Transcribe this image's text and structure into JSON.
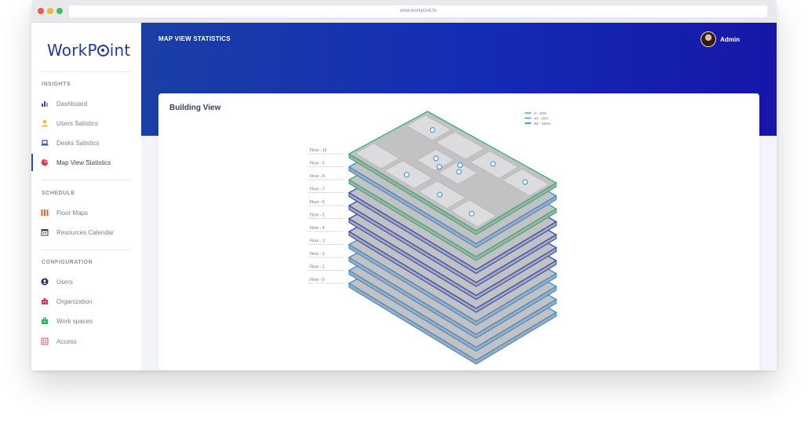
{
  "browser": {
    "url": "www.workpoint.tn"
  },
  "app": {
    "logo_prefix": "WorkP",
    "logo_suffix": "int"
  },
  "sidebar": {
    "sections": [
      {
        "title": "INSIGHTS",
        "items": [
          {
            "label": "Dashboard",
            "icon": "bar-chart-icon"
          },
          {
            "label": "Users Satistics",
            "icon": "user-icon"
          },
          {
            "label": "Desks Satistics",
            "icon": "laptop-icon"
          },
          {
            "label": "Map View Statistics",
            "icon": "pie-chart-icon",
            "active": true
          }
        ]
      },
      {
        "title": "SCHEDULE",
        "items": [
          {
            "label": "Floor Maps",
            "icon": "floor-map-icon"
          },
          {
            "label": "Resources Calendar",
            "icon": "calendar-icon"
          }
        ]
      },
      {
        "title": "CONFIGURATION",
        "items": [
          {
            "label": "Users",
            "icon": "users-icon"
          },
          {
            "label": "Organization",
            "icon": "organization-icon"
          },
          {
            "label": "Work spaces",
            "icon": "workspace-icon"
          },
          {
            "label": "Access",
            "icon": "access-icon"
          }
        ]
      }
    ]
  },
  "header": {
    "title": "MAP VIEW STATISTICS",
    "user_name": "Admin"
  },
  "card": {
    "title": "Building View"
  },
  "legend": [
    {
      "label": "0 - 40%",
      "color": "#2fb46c"
    },
    {
      "label": "40 - 80%",
      "color": "#2f8de0"
    },
    {
      "label": "80 - 100%",
      "color": "#2b47c5"
    }
  ],
  "floors": [
    {
      "label": "Floor - 10",
      "color": "#2fb46c"
    },
    {
      "label": "Floor - 9",
      "color": "#2f8de0"
    },
    {
      "label": "Floor - 8",
      "color": "#2fb46c"
    },
    {
      "label": "Floor - 7",
      "color": "#2b47c5"
    },
    {
      "label": "Floor - 6",
      "color": "#2b47c5"
    },
    {
      "label": "Floor - 5",
      "color": "#2b47c5"
    },
    {
      "label": "Floor - 4",
      "color": "#2b47c5"
    },
    {
      "label": "Floor - 3",
      "color": "#2f8de0"
    },
    {
      "label": "Floor - 2",
      "color": "#2f8de0"
    },
    {
      "label": "Floor - 1",
      "color": "#2f8de0"
    },
    {
      "label": "Floor - 0",
      "color": "#2f8de0"
    }
  ],
  "colors": {
    "header_start": "#1a3fa6",
    "header_end": "#1616a8",
    "accent": "#2b47c5"
  }
}
